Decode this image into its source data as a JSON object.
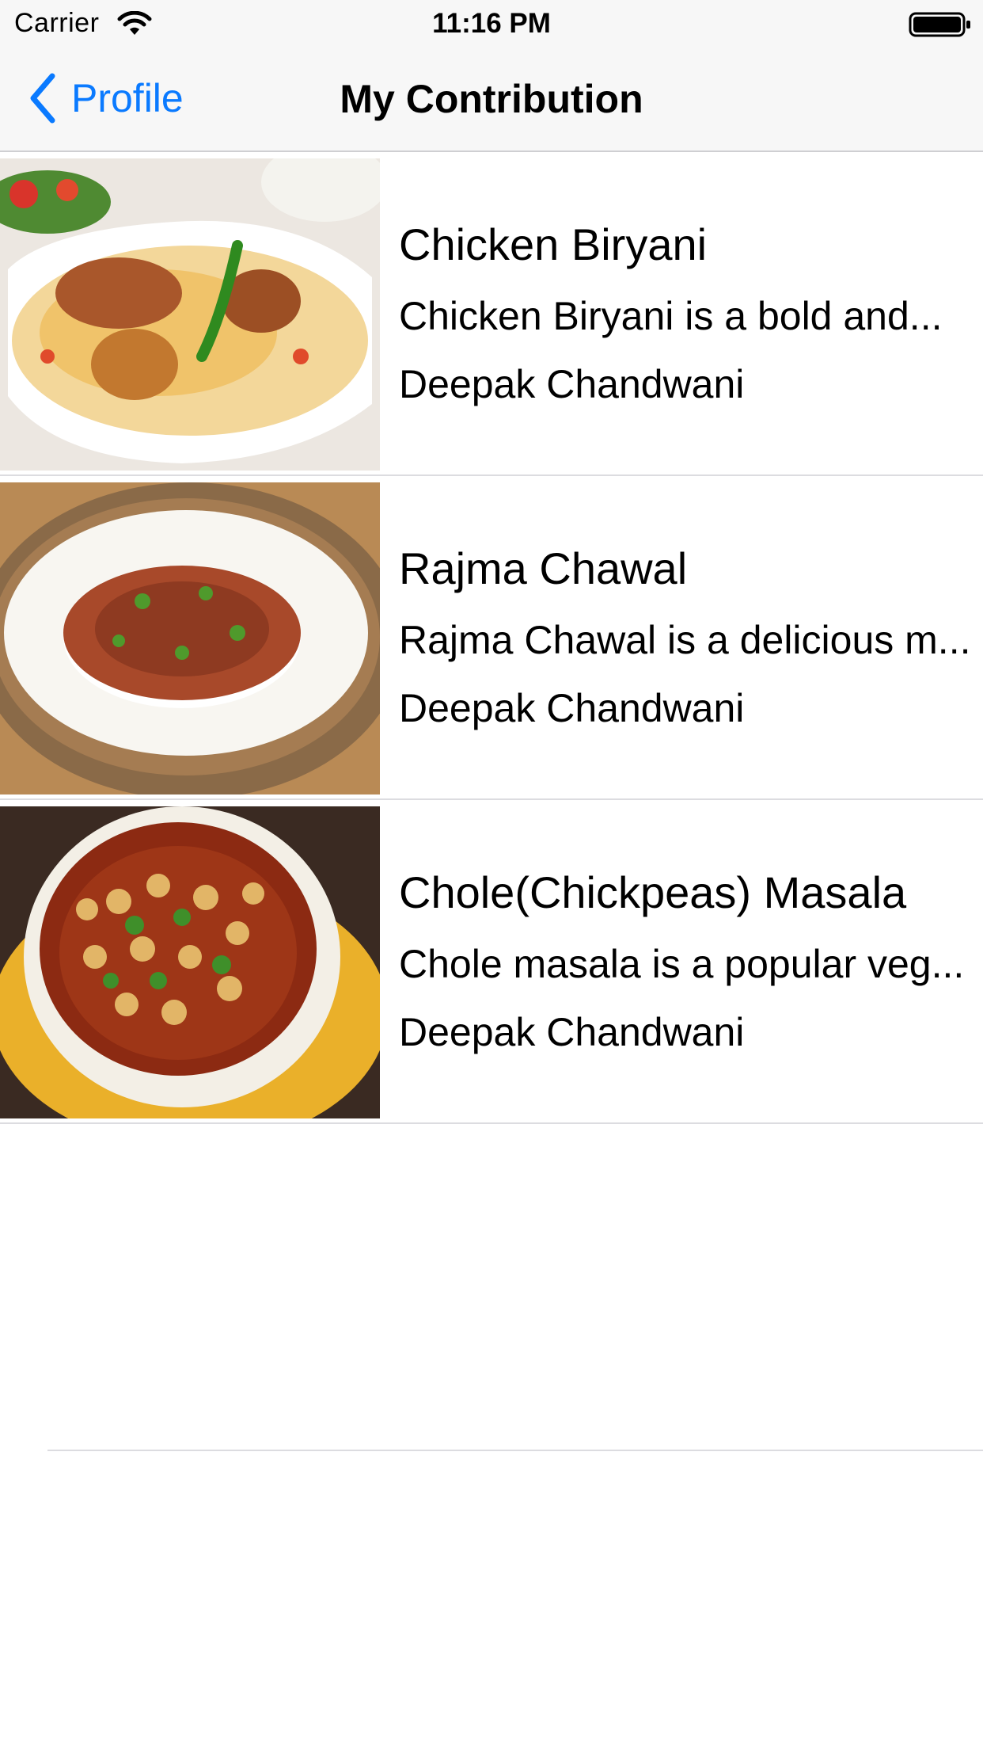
{
  "status_bar": {
    "carrier": "Carrier",
    "time": "11:16 PM",
    "icons": [
      "wifi-icon",
      "battery-icon"
    ]
  },
  "nav": {
    "back_label": "Profile",
    "back_icon": "chevron-left-icon",
    "title": "My Contribution",
    "accent_color": "#0a7aff"
  },
  "recipes": [
    {
      "title": "Chicken Biryani",
      "description": "Chicken Biryani is a bold and...",
      "author": "Deepak Chandwani",
      "image": "chicken-biryani-photo"
    },
    {
      "title": "Rajma Chawal",
      "description": "Rajma Chawal is a delicious m...",
      "author": "Deepak Chandwani",
      "image": "rajma-chawal-photo"
    },
    {
      "title": "Chole(Chickpeas) Masala",
      "description": "Chole masala is a popular veg...",
      "author": "Deepak Chandwani",
      "image": "chole-masala-photo"
    }
  ]
}
